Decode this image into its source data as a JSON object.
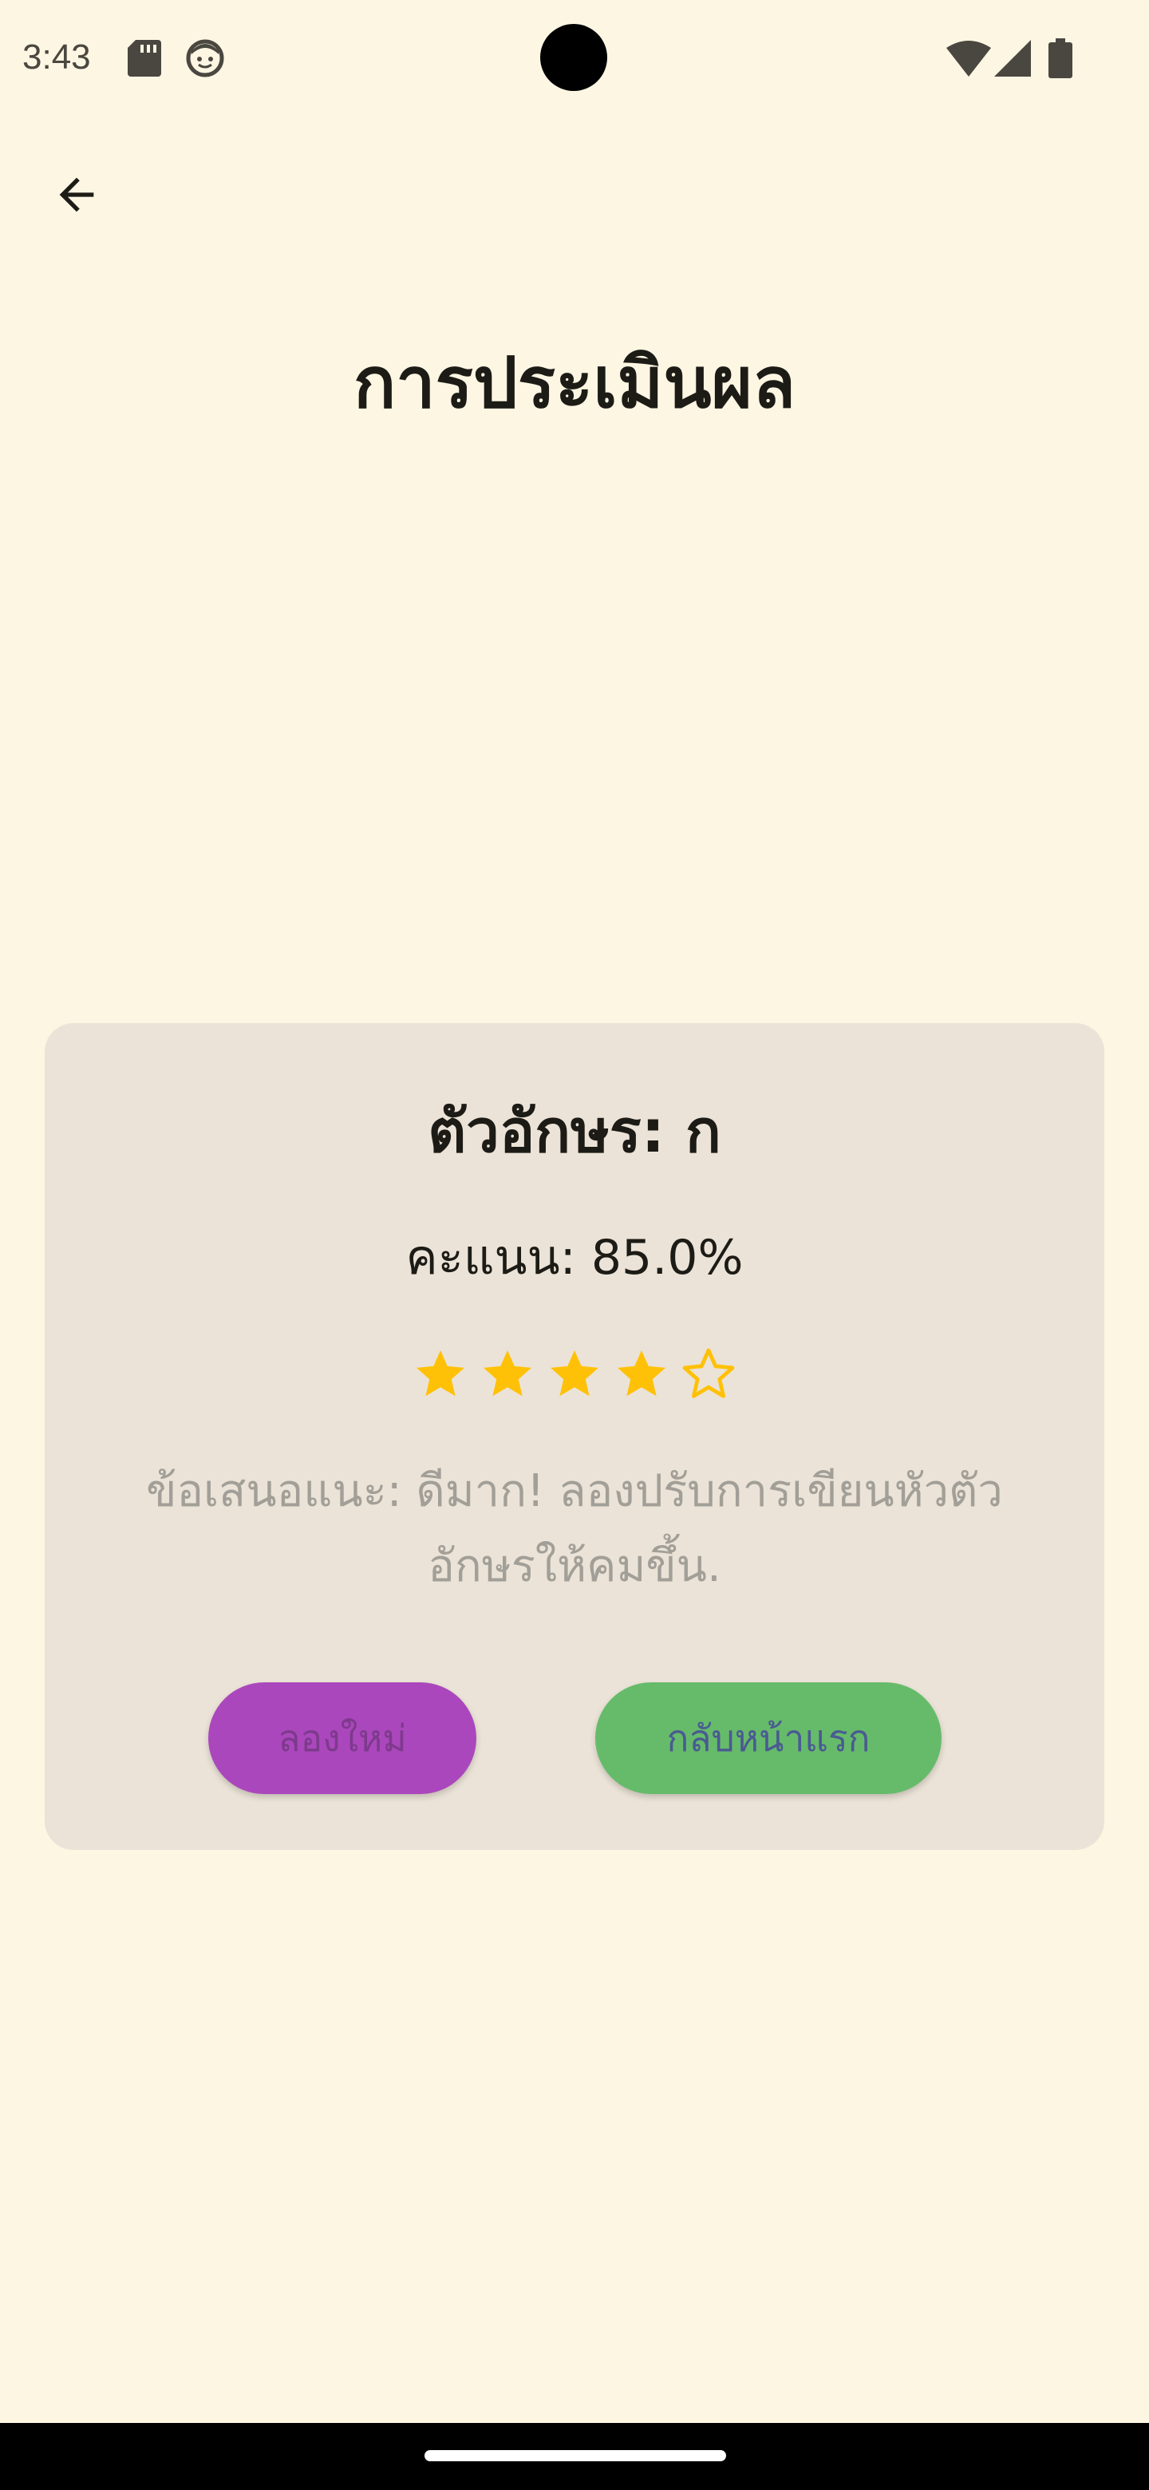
{
  "status_bar": {
    "time": "3:43",
    "icons": [
      "sd-card-icon",
      "face-icon",
      "camera-cutout",
      "wifi-icon",
      "signal-icon",
      "battery-icon"
    ]
  },
  "app_bar": {
    "back_icon": "arrow-back-icon",
    "title": "การประเมินผล"
  },
  "result": {
    "heading": "ตัวอักษร: ก",
    "score": "คะแนน: 85.0%",
    "rating": {
      "filled": 4,
      "total": 5
    },
    "feedback": "ข้อเสนอแนะ: ดีมาก! ลองปรับการเขียนหัวตัวอักษรให้คมขึ้น.",
    "retry_label": "ลองใหม่",
    "home_label": "กลับหน้าแรก"
  },
  "colors": {
    "background": "#FDF6E3",
    "card": "#EBE3D7",
    "star": "#FFC107",
    "retry_button": "#AB47BC",
    "home_button": "#66BB6A"
  }
}
